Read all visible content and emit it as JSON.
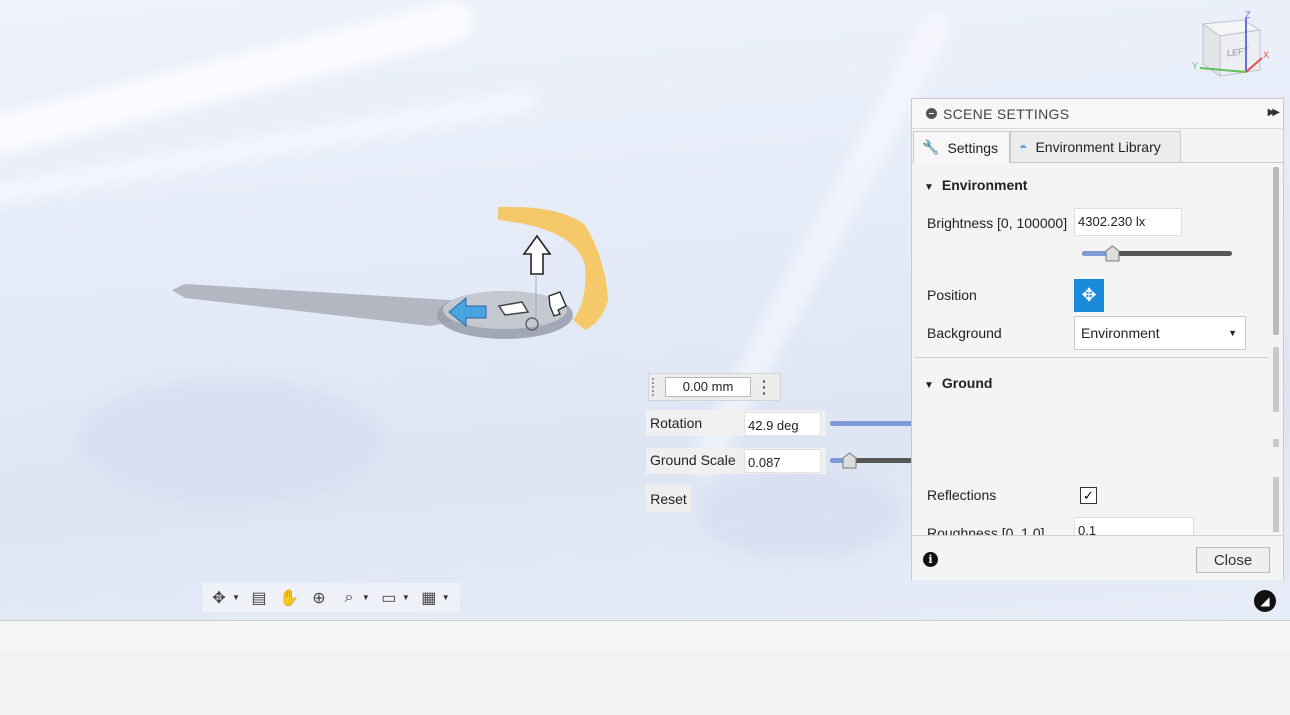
{
  "scene_settings": {
    "title": "SCENE SETTINGS",
    "tabs": [
      {
        "label": "Settings",
        "active": true
      },
      {
        "label": "Environment Library",
        "active": false
      }
    ],
    "environment": {
      "section_title": "Environment",
      "brightness_label": "Brightness [0, 100000]",
      "brightness_value": "4302.230 lx",
      "brightness_slider_fraction": 0.2,
      "position_label": "Position",
      "background_label": "Background",
      "background_value": "Environment"
    },
    "ground": {
      "section_title": "Ground",
      "reflections_label": "Reflections",
      "reflections_checked": true,
      "roughness_label": "Roughness [0, 1.0]",
      "roughness_value": "0.1"
    },
    "close_label": "Close"
  },
  "floating": {
    "dimension_value": "0.00 mm",
    "rotation_label": "Rotation",
    "rotation_value": "42.9 deg",
    "rotation_fraction": 0.62,
    "ground_scale_label": "Ground Scale",
    "ground_scale_value": "0.087",
    "ground_scale_fraction": 0.045,
    "reset_label": "Reset"
  },
  "viewcube": {
    "face_label": "LEFT",
    "axis_x": "X",
    "axis_y": "Y",
    "axis_z": "Z"
  },
  "colors": {
    "accent": "#1a8bd8",
    "slider_fill": "#7f9ad6",
    "gizmo_orange": "#f5c96a",
    "gizmo_blue": "#4aa3df"
  }
}
